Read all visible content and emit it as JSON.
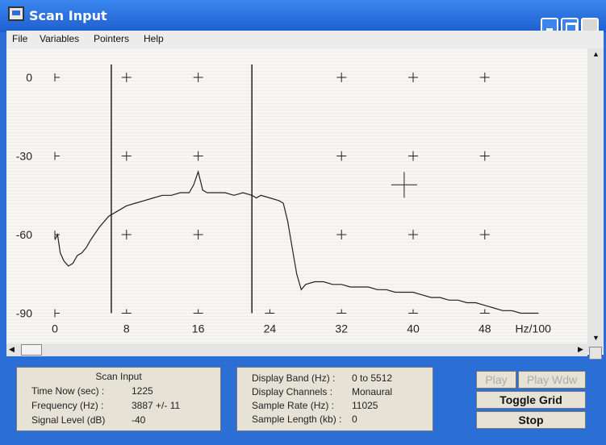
{
  "window": {
    "title": "Scan Input"
  },
  "menu": [
    "File",
    "Variables",
    "Pointers",
    "Help"
  ],
  "plot": {
    "y_ticks": [
      "0",
      "-30",
      "-60",
      "-90"
    ],
    "x_ticks": [
      "0",
      "8",
      "16",
      "24",
      "32",
      "40",
      "48"
    ],
    "x_unit": "Hz/100"
  },
  "chart_data": {
    "type": "line",
    "xlabel": "Hz/100",
    "ylabel": "",
    "xlim": [
      0,
      56
    ],
    "ylim": [
      -90,
      0
    ],
    "cursors": [
      6.3,
      22
    ],
    "series": [
      {
        "x": [
          0,
          0.3,
          0.6,
          1,
          1.5,
          2,
          2.5,
          3,
          3.5,
          4,
          5,
          6,
          7,
          8,
          9,
          10,
          11,
          12,
          13,
          14,
          15,
          15.5,
          16,
          16.5,
          17,
          18,
          19,
          20,
          21,
          22,
          22.5,
          23,
          24,
          25,
          25.5,
          26,
          26.5,
          27,
          27.5,
          28,
          29,
          30,
          31,
          32,
          33,
          34,
          35,
          36,
          37,
          38,
          39,
          40,
          41,
          42,
          43,
          44,
          45,
          46,
          47,
          48,
          49,
          50,
          51,
          52,
          53,
          54
        ],
        "y": [
          -62,
          -60,
          -67,
          -70,
          -72,
          -71,
          -68,
          -67,
          -65,
          -62,
          -57,
          -53,
          -51,
          -49,
          -48,
          -47,
          -46,
          -45,
          -45,
          -44,
          -44,
          -41,
          -36,
          -43,
          -44,
          -44,
          -44,
          -45,
          -44,
          -45,
          -46,
          -45,
          -46,
          -47,
          -48,
          -55,
          -65,
          -75,
          -81,
          -79,
          -78,
          -78,
          -79,
          -79,
          -80,
          -80,
          -80,
          -81,
          -81,
          -82,
          -82,
          -82,
          -83,
          -84,
          -84,
          -85,
          -85,
          -86,
          -86,
          -87,
          -88,
          -89,
          -89,
          -90,
          -90,
          -90
        ]
      }
    ]
  },
  "scan_panel": {
    "title": "Scan Input",
    "time_label": "Time Now (sec) :",
    "time_value": "1225",
    "freq_label": "Frequency (Hz) :",
    "freq_value": "3887 +/- 11",
    "signal_label": "Signal Level (dB)",
    "signal_value": "-40"
  },
  "display_panel": {
    "band_label": "Display Band (Hz) :",
    "band_value": "0 to 5512",
    "channels_label": "Display Channels :",
    "channels_value": "Monaural",
    "rate_label": "Sample Rate (Hz) :",
    "rate_value": "11025",
    "length_label": "Sample Length (kb) :",
    "length_value": "0"
  },
  "buttons": {
    "play": "Play",
    "play_wdw": "Play Wdw",
    "toggle_grid": "Toggle Grid",
    "stop": "Stop"
  }
}
